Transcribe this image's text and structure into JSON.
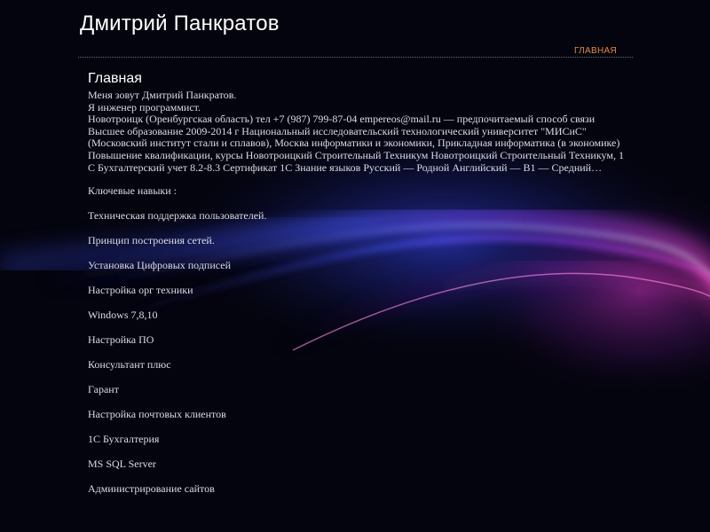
{
  "header": {
    "site_title": "Дмитрий Панкратов",
    "nav": [
      {
        "label": "ГЛАВНАЯ"
      }
    ]
  },
  "main": {
    "heading": "Главная",
    "intro": [
      "Меня зовут Дмитрий Панкратов.",
      "Я инженер программист.",
      "Новотроицк (Оренбургская область) тел +7 (987) 799-87-04 empereos@mail.ru — предпочитаемый способ связи",
      "Высшее образование 2009-2014 г Национальный исследовательский технологический университет \"МИСиС\" (Московский институт стали и сплавов), Москва информатики и экономики, Прикладная информатика (в экономике)",
      "Повышение квалификации, курсы Новотроицкий Строительный Техникум Новотроицкий Строительный Техникум, 1 С Бухгалтерский учет 8.2-8.3 Сертификат 1С Знание языков Русский — Родной Английский — B1 — Средний…"
    ],
    "skills_title": "Ключевые навыки :",
    "skills": [
      "Техническая поддержка пользователей.",
      "Принцип построения сетей.",
      "Установка Цифровых подписей",
      "Настройка орг техники",
      "Windows 7,8,10",
      "Настройка ПО",
      "Консультант плюс",
      "Гарант",
      "Настройка почтовых клиентов",
      "1С Бухгалтерия",
      "MS SQL Server",
      "Администрирование сайтов"
    ]
  },
  "theme": {
    "background": "#04040e",
    "accent": "#e2883c",
    "text": "#dcdce6",
    "title": "#ffffff"
  }
}
